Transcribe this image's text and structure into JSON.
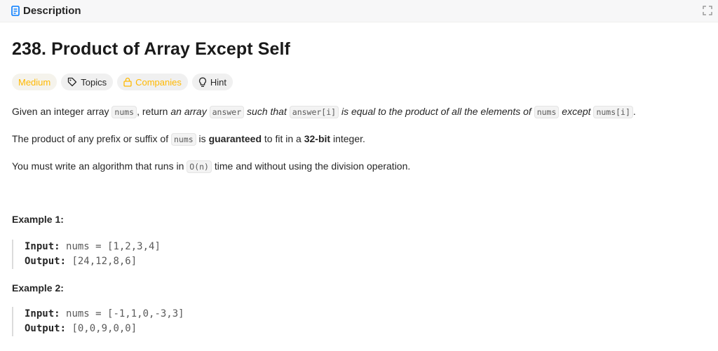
{
  "header": {
    "tab_label": "Description"
  },
  "problem": {
    "title": "238. Product of Array Except Self",
    "tags": {
      "difficulty": "Medium",
      "topics": "Topics",
      "companies": "Companies",
      "hint": "Hint"
    },
    "p1": {
      "t1": "Given an integer array ",
      "c1": "nums",
      "t2": ", return ",
      "e1": "an array",
      "c2": "answer",
      "e2": "such that",
      "c3": "answer[i]",
      "e3": "is equal to the product of all the elements of",
      "c4": "nums",
      "e4": "except",
      "c5": "nums[i]",
      "t3": "."
    },
    "p2": {
      "t1": "The product of any prefix or suffix of ",
      "c1": "nums",
      "t2": " is ",
      "b1": "guaranteed",
      "t3": " to fit in a ",
      "b2": "32-bit",
      "t4": " integer."
    },
    "p3": {
      "t1": "You must write an algorithm that runs in ",
      "c1": "O(n)",
      "t2": " time and without using the division operation."
    },
    "examples": [
      {
        "title": "Example 1:",
        "input_label": "Input:",
        "input": "nums = [1,2,3,4]",
        "output_label": "Output:",
        "output": "[24,12,8,6]"
      },
      {
        "title": "Example 2:",
        "input_label": "Input:",
        "input": "nums = [-1,1,0,-3,3]",
        "output_label": "Output:",
        "output": "[0,0,9,0,0]"
      }
    ]
  },
  "colors": {
    "accent_blue": "#007aff",
    "medium": "#ffb800"
  },
  "icons": {
    "tab": "description-icon",
    "expand": "expand-icon",
    "topics": "tag-icon",
    "companies": "lock-icon",
    "hint": "lightbulb-icon"
  }
}
